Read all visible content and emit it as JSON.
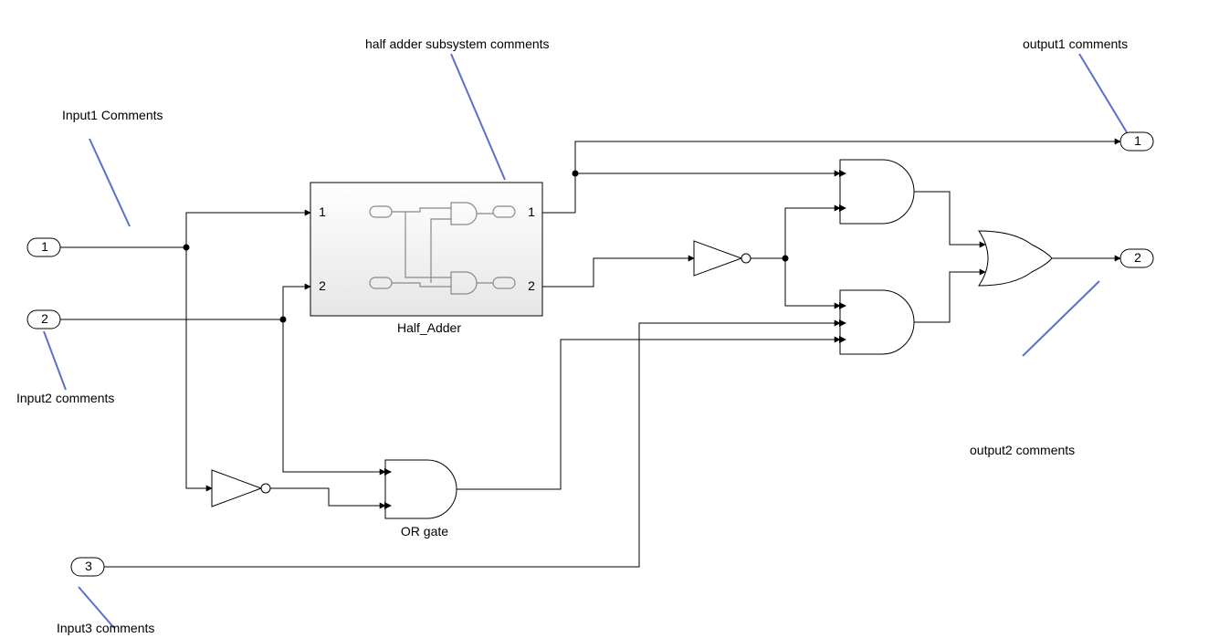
{
  "annotations": {
    "input1": "Input1 Comments",
    "input2": "Input2 comments",
    "input3": "Input3 comments",
    "halfAdder": "half adder subsystem comments",
    "output1": "output1 comments",
    "output2": "output2 comments"
  },
  "labels": {
    "halfAdder": "Half_Adder",
    "orGate": "OR gate"
  },
  "ports": {
    "in1": "1",
    "in2": "2",
    "in3": "3",
    "out1": "1",
    "out2": "2",
    "subIn1": "1",
    "subIn2": "2",
    "subOut1": "1",
    "subOut2": "2"
  },
  "colors": {
    "annotationLine": "#5b6fcc",
    "blockStroke": "#000000",
    "wire": "#000000",
    "subsysTop": "#ffffff",
    "subsysBottom": "#e8e8e8"
  }
}
